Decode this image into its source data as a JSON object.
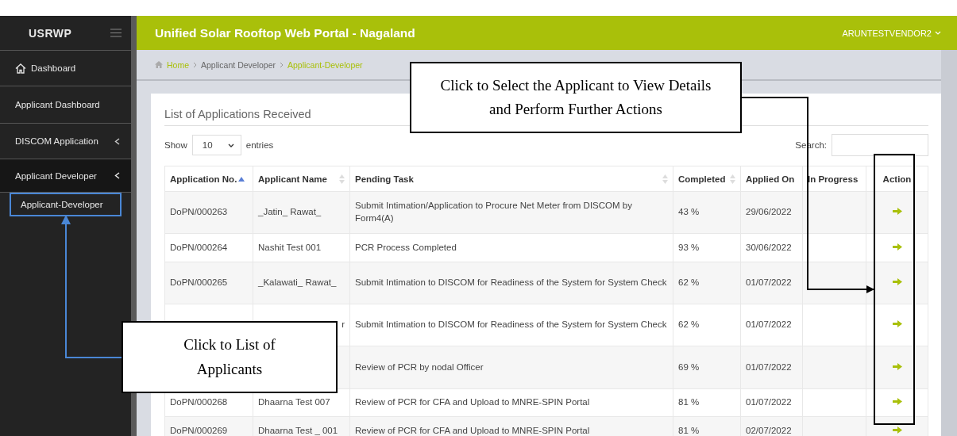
{
  "header": {
    "brand": "USRWP",
    "title": "Unified Solar Rooftop Web Portal - Nagaland",
    "user": "ARUNTESTVENDOR2"
  },
  "sidebar": {
    "items": [
      {
        "label": "Dashboard",
        "kind": "home",
        "expanded": false
      },
      {
        "label": "Applicant Dashboard",
        "kind": "plain",
        "expanded": false
      },
      {
        "label": "DISCOM Application",
        "kind": "group",
        "expanded": false
      },
      {
        "label": "Applicant Developer",
        "kind": "group",
        "expanded": true,
        "children": [
          {
            "label": "Applicant-Developer",
            "selected": true
          }
        ]
      }
    ]
  },
  "breadcrumb": [
    "Home",
    "Applicant Developer",
    "Applicant-Developer"
  ],
  "card": {
    "title": "List of Applications Received",
    "show_label": "Show",
    "page_size": "10",
    "entries_label": "entries",
    "search_label": "Search:"
  },
  "table": {
    "columns": [
      {
        "label": "Application No.",
        "sorted": true
      },
      {
        "label": "Applicant Name",
        "sorted": false
      },
      {
        "label": "Pending Task",
        "sorted": false
      },
      {
        "label": "Completed",
        "sorted": false
      },
      {
        "label": "Applied On"
      },
      {
        "label": "In Progress"
      },
      {
        "label": "Action"
      }
    ],
    "rows": [
      {
        "app_no": "DoPN/000263",
        "name": "_Jatin_ Rawat_",
        "task": "Submit Intimation/Application to Procure Net Meter from DISCOM by Form4(A)",
        "completed": "43 %",
        "applied_on": "29/06/2022"
      },
      {
        "app_no": "DoPN/000264",
        "name": "Nashit Test 001",
        "task": "PCR Process Completed",
        "completed": "93 %",
        "applied_on": "30/06/2022"
      },
      {
        "app_no": "DoPN/000265",
        "name": "_Kalawati_ Rawat_",
        "task": "Submit Intimation to DISCOM for Readiness of the System for System Check",
        "completed": "62 %",
        "applied_on": "01/07/2022"
      },
      {
        "name": "r",
        "task": "Submit Intimation to DISCOM for Readiness of the System for System Check",
        "completed": "62 %",
        "applied_on": "01/07/2022"
      },
      {
        "task": "Review of PCR by nodal Officer",
        "completed": "69 %",
        "applied_on": "01/07/2022"
      },
      {
        "app_no": "DoPN/000268",
        "name": "Dhaarna Test 007",
        "task": "Review of PCR for CFA and Upload to MNRE-SPIN Portal",
        "completed": "81 %",
        "applied_on": "01/07/2022"
      },
      {
        "app_no": "DoPN/000269",
        "name": "Dhaarna Test _ 001",
        "task": "Review of PCR for CFA and Upload to MNRE-SPIN Portal",
        "completed": "81 %",
        "applied_on": "02/07/2022"
      }
    ]
  },
  "callouts": [
    {
      "text": "Click to Select the Applicant to View Details and Perform Further Actions",
      "kind": "top"
    },
    {
      "text": "Click to List of Applicants",
      "kind": "bottom"
    }
  ]
}
